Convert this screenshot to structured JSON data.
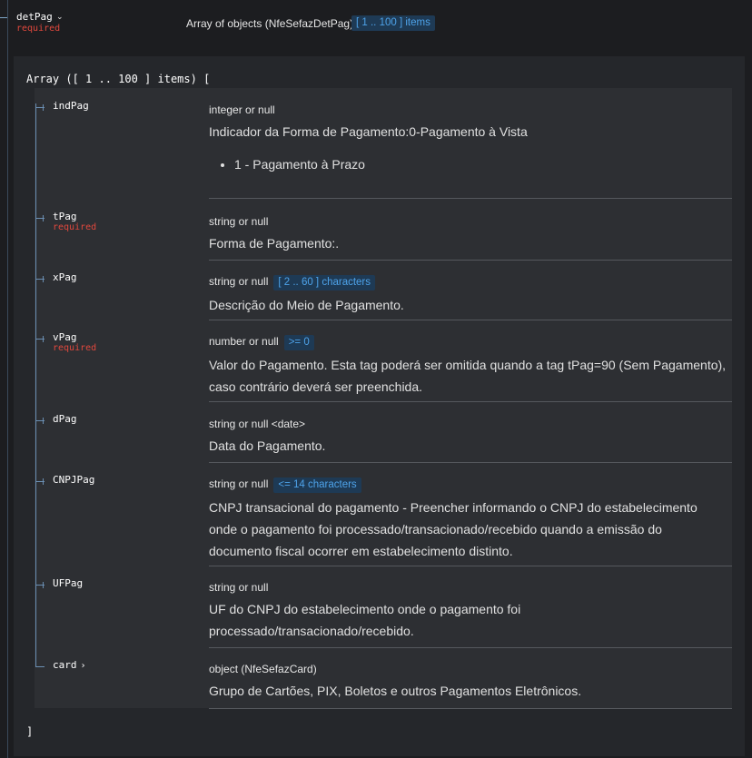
{
  "header": {
    "name": "detPag",
    "required": "required",
    "type": "Array of objects (NfeSefazDetPag)",
    "badge": "[ 1 .. 100 ] items"
  },
  "array": {
    "open": "Array ([ 1 .. 100 ] items) [",
    "close": "]"
  },
  "properties": [
    {
      "name": "indPag",
      "type": "integer or null",
      "description": "Indicador da Forma de Pagamento:0-Pagamento à Vista",
      "bullets": [
        "1 - Pagamento à Prazo"
      ]
    },
    {
      "name": "tPag",
      "required": "required",
      "type": "string or null",
      "description": "Forma de Pagamento:."
    },
    {
      "name": "xPag",
      "type": "string or null",
      "badge": "[ 2 .. 60 ] characters",
      "description": "Descrição do Meio de Pagamento."
    },
    {
      "name": "vPag",
      "required": "required",
      "type": "number or null",
      "badge": ">= 0",
      "description": "Valor do Pagamento. Esta tag poderá ser omitida quando a tag tPag=90 (Sem Pagamento), caso contrário deverá ser preenchida."
    },
    {
      "name": "dPag",
      "type": "string or null <date>",
      "description": "Data do Pagamento."
    },
    {
      "name": "CNPJPag",
      "type": "string or null",
      "badge": "<= 14 characters",
      "description": "CNPJ transacional do pagamento - Preencher informando o CNPJ do estabelecimento onde o pagamento foi processado/transacionado/recebido quando a emissão do documento fiscal ocorrer em estabelecimento distinto."
    },
    {
      "name": "UFPag",
      "type": "string or null",
      "description": "UF do CNPJ do estabelecimento onde o pagamento foi processado/transacionado/recebido."
    },
    {
      "name": "card",
      "type": "object (NfeSefazCard)",
      "description": "Grupo de Cartões, PIX, Boletos e outros Pagamentos Eletrônicos."
    }
  ]
}
